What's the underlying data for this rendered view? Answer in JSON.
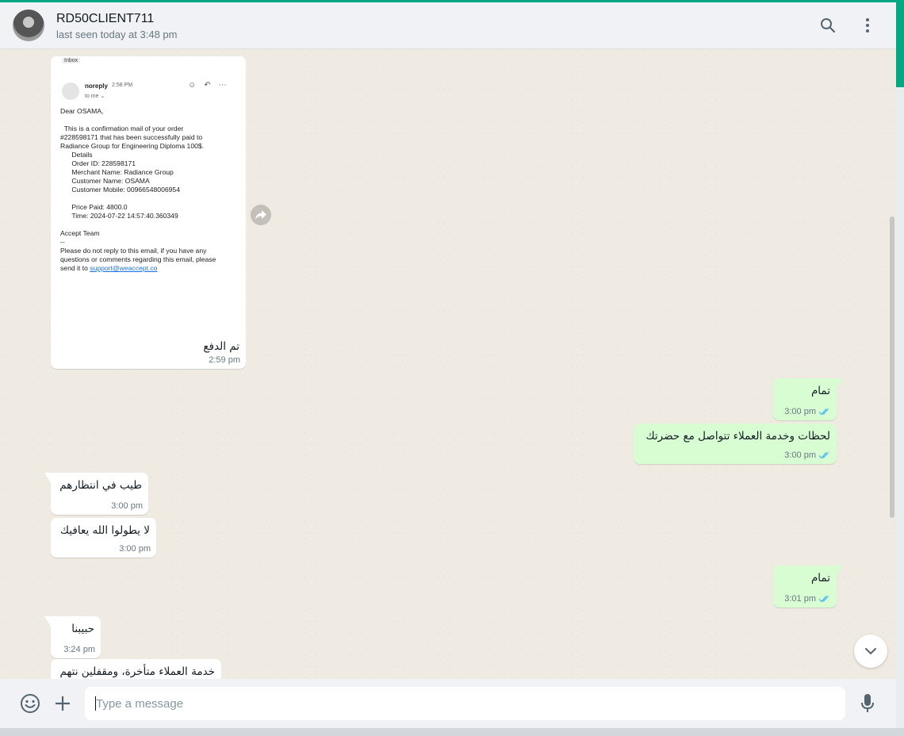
{
  "header": {
    "contact_name": "RD50CLIENT711",
    "status": "last seen today at 3:48 pm",
    "search_icon": "search-icon",
    "menu_icon": "more-vertical-icon"
  },
  "email_screenshot": {
    "inbox_tag": "Inbox",
    "sender": "noreply",
    "sent_time": "2:58 PM",
    "to_me": "to me ⌄",
    "greeting": "Dear OSAMA,",
    "body_1": "  This is a confirmation mail of your order\n#228598171 that has been successfully paid to\nRadiance Group for Engineering Diploma 100$.",
    "details_title": "      Details",
    "order_id": "      Order ID: 228598171",
    "merchant": "      Merchant Name: Radiance Group",
    "customer_name": "      Customer Name: OSAMA",
    "customer_mobile": "      Customer Mobile: 00966548006954",
    "price_paid": "      Price Paid: 4800.0",
    "time": "      Time: 2024-07-22 14:57:40.360349",
    "signoff": "Accept Team",
    "dashes": "--",
    "footer": "Please do not reply to this email, if you have any\nquestions or comments regarding this email, please\nsend it to ",
    "support_link": "support@weaccept.co"
  },
  "messages": [
    {
      "id": "m1",
      "direction": "in",
      "text": "تم الدفع",
      "time": "2:59 pm"
    },
    {
      "id": "m2",
      "direction": "out",
      "text": "تمام",
      "time": "3:00 pm"
    },
    {
      "id": "m3",
      "direction": "out",
      "text": "لحظات وخدمة العملاء تتواصل مع حضرتك",
      "time": "3:00 pm"
    },
    {
      "id": "m4",
      "direction": "in",
      "text": "طيب في انتظارهم",
      "time": "3:00 pm"
    },
    {
      "id": "m5",
      "direction": "in",
      "text": "لا يطولوا الله يعافيك",
      "time": "3:00 pm"
    },
    {
      "id": "m6",
      "direction": "out",
      "text": "تمام",
      "time": "3:01 pm"
    },
    {
      "id": "m7",
      "direction": "in",
      "text": "حبيبنا",
      "time": "3:24 pm"
    },
    {
      "id": "m8",
      "direction": "in",
      "text": "خدمة العملاء متأخرة، ومقفلين نتهم",
      "time": ""
    }
  ],
  "composer": {
    "placeholder": "Type a message",
    "emoji_icon": "emoji-icon",
    "attach_icon": "plus-icon",
    "mic_icon": "microphone-icon"
  },
  "colors": {
    "accent": "#00a884",
    "outgoing_bubble": "#d9fdd3",
    "incoming_bubble": "#ffffff",
    "read_ticks": "#53bdeb"
  }
}
